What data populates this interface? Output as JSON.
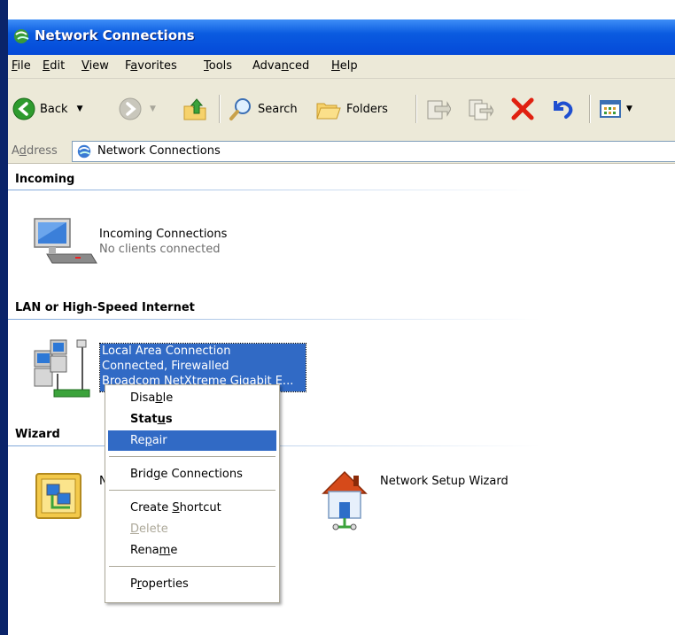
{
  "window": {
    "title": "Network Connections"
  },
  "menu": [
    {
      "pre": "",
      "ul": "F",
      "post": "ile"
    },
    {
      "pre": "",
      "ul": "E",
      "post": "dit"
    },
    {
      "pre": "",
      "ul": "V",
      "post": "iew"
    },
    {
      "pre": "F",
      "ul": "a",
      "post": "vorites"
    },
    {
      "pre": "",
      "ul": "T",
      "post": "ools"
    },
    {
      "pre": "Adva",
      "ul": "n",
      "post": "ced"
    },
    {
      "pre": "",
      "ul": "H",
      "post": "elp"
    }
  ],
  "toolbar": {
    "back": "Back",
    "search": "Search",
    "folders": "Folders"
  },
  "address": {
    "label_pre": "A",
    "label_ul": "d",
    "label_post": "dress",
    "value": "Network Connections"
  },
  "groups": {
    "incoming": "Incoming",
    "lan": "LAN or High-Speed Internet",
    "wizard": "Wizard"
  },
  "items": {
    "incoming": {
      "name": "Incoming Connections",
      "status": "No clients connected"
    },
    "lan": {
      "line1": "Local Area Connection",
      "line2": "Connected, Firewalled",
      "line3": "Broadcom NetXtreme Gigabit E..."
    },
    "new_conn_partial": "N",
    "setup_wizard": "Network Setup Wizard"
  },
  "context_menu": {
    "disable": {
      "pre": "Disa",
      "ul": "b",
      "post": "le"
    },
    "status": {
      "pre": "Stat",
      "ul": "u",
      "post": "s"
    },
    "repair": {
      "pre": "Re",
      "ul": "p",
      "post": "air"
    },
    "bridge": {
      "pre": "Brid",
      "ul": "g",
      "post": "e Connections"
    },
    "shortcut": {
      "pre": "Create ",
      "ul": "S",
      "post": "hortcut"
    },
    "delete": {
      "pre": "",
      "ul": "D",
      "post": "elete"
    },
    "rename": {
      "pre": "Rena",
      "ul": "m",
      "post": "e"
    },
    "properties": {
      "pre": "P",
      "ul": "r",
      "post": "operties"
    }
  },
  "colors": {
    "title_blue": "#0a5be0",
    "selection": "#316ac5",
    "chrome": "#ece9d8"
  }
}
